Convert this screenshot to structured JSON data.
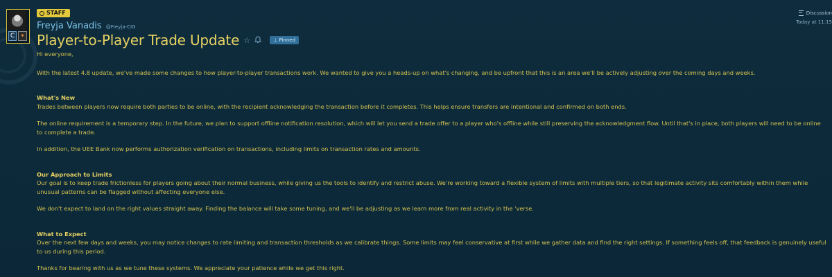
{
  "author": {
    "badge": "STAFF",
    "name": "Freyja Vanadis",
    "handle": "@Freyja-CIG"
  },
  "post": {
    "title": "Player-to-Player Trade Update",
    "pinned_label": "Pinned"
  },
  "meta": {
    "category": "Discussion",
    "time": "Today at 11:15"
  },
  "content": {
    "greeting": "Hi everyone,",
    "intro": "With the latest 4.8 update, we've made some changes to how player-to-player transactions work. We wanted to give you a heads-up on what's changing, and be upfront that this is an area we'll be actively adjusting over the coming days and weeks.",
    "section1_heading": "What's New",
    "section1_p1": "Trades between players now require both parties to be online, with the recipient acknowledging the transaction before it completes. This helps ensure transfers are intentional and confirmed on both ends.",
    "section1_p2": "The online requirement is a temporary step. In the future, we plan to support offline notification resolution, which will let you send a trade offer to a player who's offline while still preserving the acknowledgment flow. Until that's in place, both players will need to be online to complete a trade.",
    "section1_p3": "In addition, the UEE Bank now performs authorization verification on transactions, including limits on transaction rates and amounts.",
    "section2_heading": "Our Approach to Limits",
    "section2_p1": "Our goal is to keep trade frictionless for players going about their normal business, while giving us the tools to identify and restrict abuse. We're working toward a flexible system of limits with multiple tiers, so that legitimate activity sits comfortably within them while unusual patterns can be flagged without affecting everyone else.",
    "section2_p2": "We don't expect to land on the right values straight away. Finding the balance will take some tuning, and we'll be adjusting as we learn more from real activity in the 'verse.",
    "section3_heading": "What to Expect",
    "section3_p1": "Over the next few days and weeks, you may notice changes to rate limiting and transaction thresholds as we calibrate things. Some limits may feel conservative at first while we gather data and find the right settings. If something feels off, that feedback is genuinely useful to us during this period.",
    "section3_p2": "Thanks for bearing with us as we tune these systems. We appreciate your patience while we get this right."
  },
  "icons": {
    "gear": "gear-icon",
    "star": "star-icon",
    "bell": "bell-icon",
    "pin": "pin-icon",
    "discussion": "discussion-icon"
  },
  "colors": {
    "background": "#0d2a3a",
    "text": "#d4c24f",
    "title": "#e7d262",
    "author": "#7fc4ea",
    "staff_badge": "#e3c93b",
    "pinned_badge": "#2f6f9a"
  }
}
